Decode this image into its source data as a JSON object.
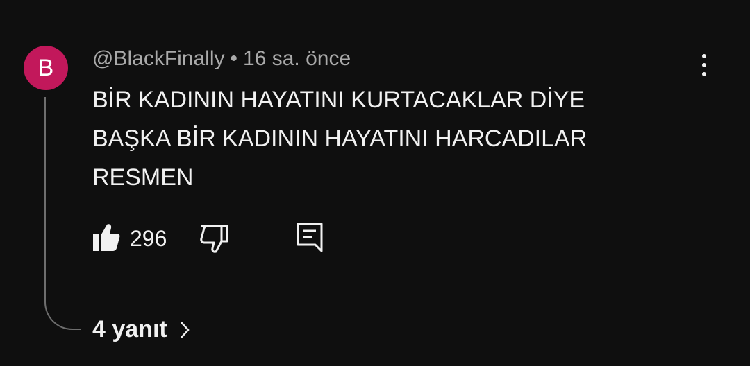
{
  "comment": {
    "avatar_letter": "B",
    "avatar_color": "#c2185b",
    "author": "@BlackFinally",
    "separator": "•",
    "time": "16 sa. önce",
    "text_lines": [
      "BİR KADININ HAYATINI KURTACAKLAR DİYE",
      "BAŞKA BİR KADININ HAYATINI HARCADILAR",
      "RESMEN"
    ],
    "like_count": "296",
    "replies_label": "4 yanıt"
  },
  "icons": {
    "like": "thumbs-up-icon",
    "dislike": "thumbs-down-icon",
    "reply": "comment-reply-icon",
    "more": "more-vertical-icon",
    "chevron": "chevron-right-icon"
  }
}
